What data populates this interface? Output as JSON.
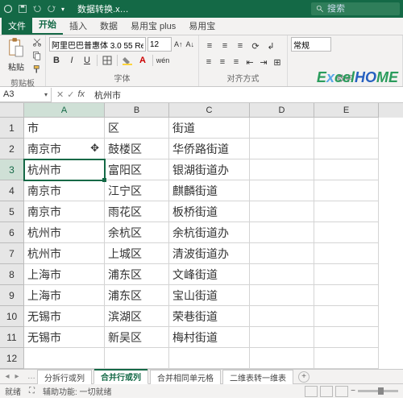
{
  "titlebar": {
    "filename": "数据转换.x…",
    "search_placeholder": "搜索"
  },
  "tabs": {
    "file": "文件",
    "home": "开始",
    "insert": "插入",
    "data": "数据",
    "yyb_plus": "易用宝 plus",
    "yyb": "易用宝"
  },
  "ribbon": {
    "paste_label": "粘贴",
    "clipboard_group": "剪贴板",
    "font_name": "阿里巴巴普惠体 3.0 55 Regu",
    "font_size": "12",
    "font_group": "字体",
    "align_group": "对齐方式",
    "number_format": "常规",
    "number_group": "数字",
    "bold": "B",
    "italic": "I",
    "underline": "U"
  },
  "watermark": "ExcelHOME",
  "formula_bar": {
    "cell_ref": "A3",
    "fx": "fx",
    "value": "杭州市"
  },
  "columns": [
    "A",
    "B",
    "C",
    "D",
    "E"
  ],
  "rows": [
    "1",
    "2",
    "3",
    "4",
    "5",
    "6",
    "7",
    "8",
    "9",
    "10",
    "11",
    "12"
  ],
  "chart_data": {
    "type": "table",
    "headers": [
      "市",
      "区",
      "街道"
    ],
    "data": [
      [
        "市",
        "区",
        "街道",
        "",
        ""
      ],
      [
        "南京市",
        "鼓楼区",
        "华侨路街道",
        "",
        ""
      ],
      [
        "杭州市",
        "富阳区",
        "银湖街道办",
        "",
        ""
      ],
      [
        "南京市",
        "江宁区",
        "麒麟街道",
        "",
        ""
      ],
      [
        "南京市",
        "雨花区",
        "板桥街道",
        "",
        ""
      ],
      [
        "杭州市",
        "余杭区",
        "余杭街道办",
        "",
        ""
      ],
      [
        "杭州市",
        "上城区",
        "清波街道办",
        "",
        ""
      ],
      [
        "上海市",
        "浦东区",
        "文峰街道",
        "",
        ""
      ],
      [
        "上海市",
        "浦东区",
        "宝山街道",
        "",
        ""
      ],
      [
        "无锡市",
        "滨湖区",
        "荣巷街道",
        "",
        ""
      ],
      [
        "无锡市",
        "新吴区",
        "梅村街道",
        "",
        ""
      ],
      [
        "",
        "",
        "",
        "",
        ""
      ]
    ]
  },
  "sheet_tabs": {
    "t1": "分拆行或列",
    "t2": "合并行或列",
    "t3": "合并相同单元格",
    "t4": "二维表转一维表"
  },
  "status": {
    "ready": "就绪",
    "assist": "辅助功能: 一切就绪"
  }
}
